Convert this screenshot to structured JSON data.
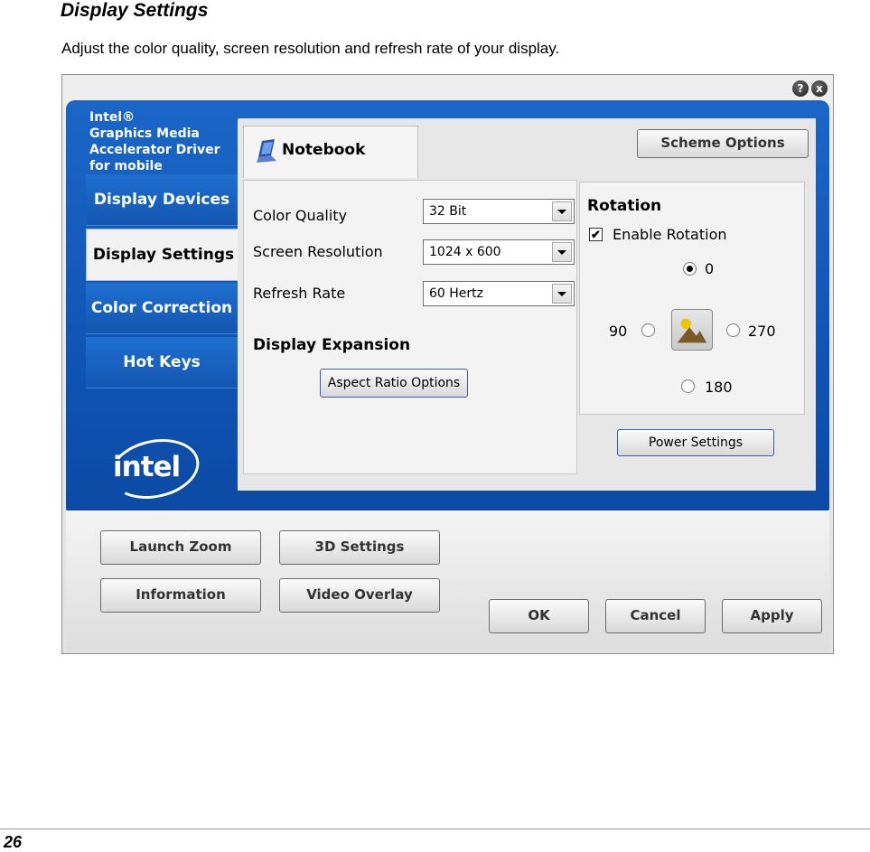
{
  "doc": {
    "title": "Display Settings",
    "description": "Adjust the color quality, screen resolution and refresh rate of your display.",
    "page_number": "26"
  },
  "window": {
    "help_glyph": "?",
    "close_glyph": "x"
  },
  "brand": {
    "lines": [
      "Intel®",
      "Graphics Media",
      "Accelerator Driver",
      "for mobile"
    ],
    "logo_text": "intel"
  },
  "nav": {
    "items": [
      {
        "label": "Display Devices"
      },
      {
        "label": "Display Settings"
      },
      {
        "label": "Color Correction"
      },
      {
        "label": "Hot Keys"
      }
    ],
    "active": "Display Settings"
  },
  "tab": {
    "label": "Notebook"
  },
  "scheme_options": "Scheme Options",
  "settings": {
    "color_quality_label": "Color Quality",
    "color_quality_value": "32 Bit",
    "resolution_label": "Screen Resolution",
    "resolution_value": "1024 x 600",
    "refresh_label": "Refresh Rate",
    "refresh_value": "60 Hertz",
    "expansion_heading": "Display Expansion",
    "aspect_button": "Aspect Ratio Options"
  },
  "rotation": {
    "heading": "Rotation",
    "enable_label": "Enable Rotation",
    "enable_checked": true,
    "check_glyph": "✔",
    "options": {
      "r0": "0",
      "r90": "90",
      "r180": "180",
      "r270": "270"
    },
    "selected": "0"
  },
  "power_settings": "Power Settings",
  "bottom": {
    "launch_zoom": "Launch Zoom",
    "settings_3d": "3D Settings",
    "information": "Information",
    "video_overlay": "Video Overlay",
    "ok": "OK",
    "cancel": "Cancel",
    "apply": "Apply"
  },
  "colors": {
    "frame_blue": "#1260c0",
    "panel_gray": "#f3f3f3"
  }
}
